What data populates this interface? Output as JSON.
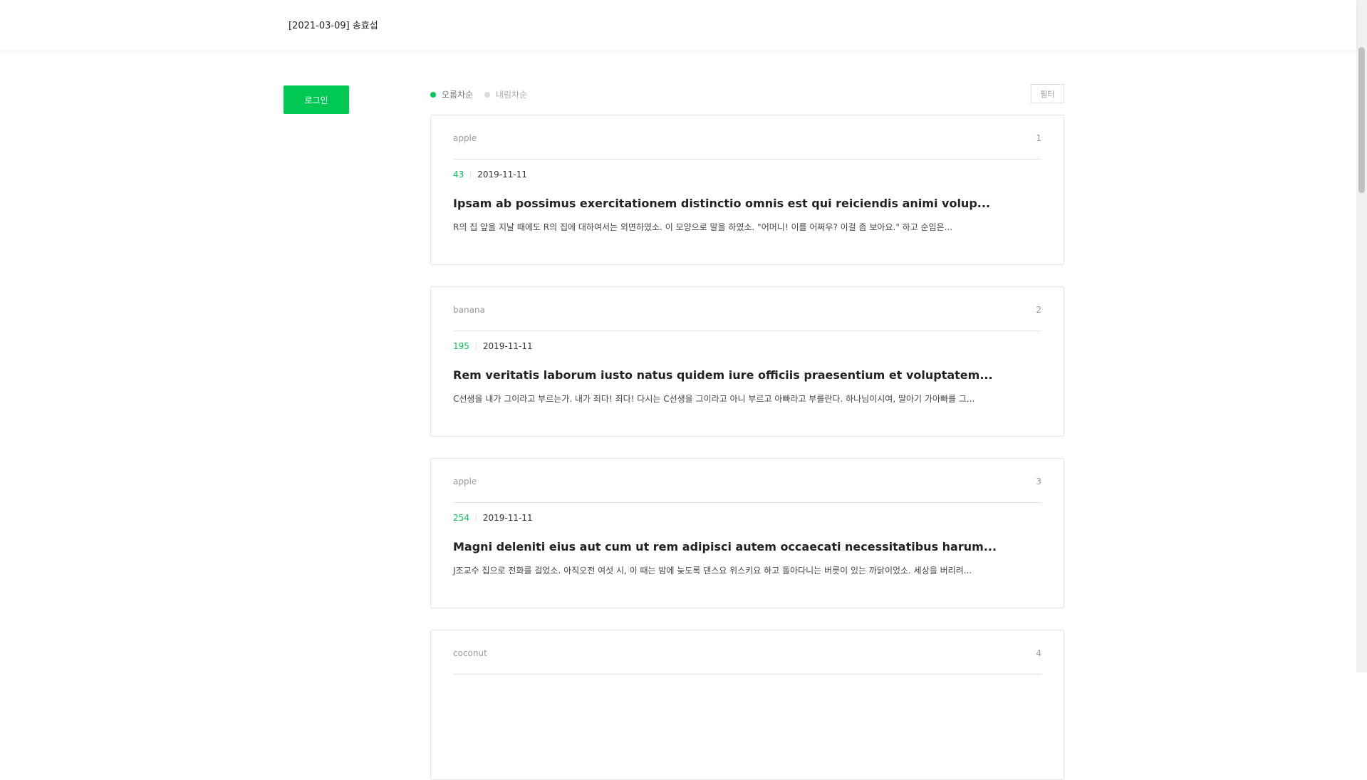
{
  "header": {
    "title": "[2021-03-09] 송효섭"
  },
  "sidebar": {
    "login_label": "로그인"
  },
  "sort": {
    "asc_label": "오름차순",
    "desc_label": "내림차순",
    "selected": "asc"
  },
  "filter": {
    "label": "필터"
  },
  "colors": {
    "accent": "#00c854",
    "border": "#e1e4e8",
    "muted": "#999999"
  },
  "posts": [
    {
      "category": "apple",
      "number": "1",
      "count": "43",
      "date": "2019-11-11",
      "title": "Ipsam ab possimus exercitationem distinctio omnis est qui reiciendis animi volup...",
      "body": "R의 집 앞을 지날 때에도 R의 집에 대하여서는 외면하였소. 이 모양으로 말을 하였소. \"어머니! 이를 어쩌우? 이걸 좀 보아요.\" 하고 순임은..."
    },
    {
      "category": "banana",
      "number": "2",
      "count": "195",
      "date": "2019-11-11",
      "title": "Rem veritatis laborum iusto natus quidem iure officiis praesentium et voluptatem...",
      "body": "C선생을 내가 그이라고 부르는가. 내가 죄다! 죄다! 다시는 C선생을 그이라고 아니 부르고 아빠라고 부를란다. 하나님이시여, 딸아기 가아빠를 그..."
    },
    {
      "category": "apple",
      "number": "3",
      "count": "254",
      "date": "2019-11-11",
      "title": "Magni deleniti eius aut cum ut rem adipisci autem occaecati necessitatibus harum...",
      "body": "J조교수 집으로 전화를 걸었소. 아직오전 여섯 시, 이 때는 밤에 늦도록 댄스요 위스키요 하고 돌아다니는 버릇이 있는 까닭이었소. 세상을 버리려..."
    },
    {
      "category": "coconut",
      "number": "4"
    }
  ]
}
